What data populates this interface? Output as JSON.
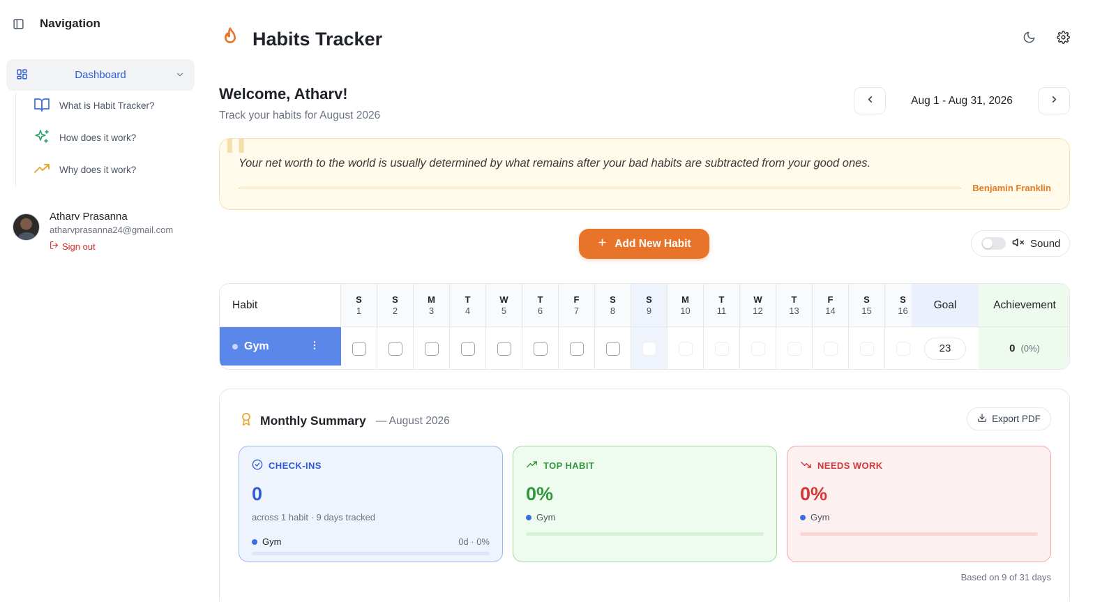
{
  "sidebar": {
    "title": "Navigation",
    "dashboard_label": "Dashboard",
    "items": [
      {
        "label": "What is Habit Tracker?",
        "icon": "book-open-icon"
      },
      {
        "label": "How does it work?",
        "icon": "sparkles-icon"
      },
      {
        "label": "Why does it work?",
        "icon": "trending-up-icon"
      }
    ],
    "user": {
      "name": "Atharv Prasanna",
      "email": "atharvprasanna24@gmail.com",
      "signout": "Sign out"
    }
  },
  "header": {
    "title": "Habits Tracker",
    "accent": "#e8742a"
  },
  "welcome": {
    "title": "Welcome, Atharv!",
    "subtitle": "Track your habits for August 2026"
  },
  "date_nav": {
    "range": "Aug 1 - Aug 31, 2026"
  },
  "quote": {
    "text": "Your net worth to the world is usually determined by what remains after your bad habits are subtracted from your good ones.",
    "author": "Benjamin Franklin"
  },
  "actions": {
    "add_habit": "Add New Habit",
    "sound_label": "Sound"
  },
  "table": {
    "habit_header": "Habit",
    "goal_header": "Goal",
    "achievement_header": "Achievement",
    "days": [
      {
        "w": "S",
        "n": "1"
      },
      {
        "w": "S",
        "n": "2"
      },
      {
        "w": "M",
        "n": "3"
      },
      {
        "w": "T",
        "n": "4"
      },
      {
        "w": "W",
        "n": "5"
      },
      {
        "w": "T",
        "n": "6"
      },
      {
        "w": "F",
        "n": "7"
      },
      {
        "w": "S",
        "n": "8"
      },
      {
        "w": "S",
        "n": "9"
      },
      {
        "w": "M",
        "n": "10"
      },
      {
        "w": "T",
        "n": "11"
      },
      {
        "w": "W",
        "n": "12"
      },
      {
        "w": "T",
        "n": "13"
      },
      {
        "w": "F",
        "n": "14"
      },
      {
        "w": "S",
        "n": "15"
      },
      {
        "w": "S",
        "n": "16"
      }
    ],
    "habit": {
      "name": "Gym",
      "color": "#5b86ea",
      "goal": "23",
      "achievement": "0",
      "achievement_pct": "(0%)"
    }
  },
  "summary": {
    "title": "Monthly Summary",
    "month": "— August 2026",
    "export": "Export PDF",
    "checkins": {
      "label": "CHECK-INS",
      "value": "0",
      "sub": "across 1 habit · 9 days tracked",
      "habit": "Gym",
      "stat": "0d · 0%"
    },
    "top": {
      "label": "TOP HABIT",
      "value": "0%",
      "habit": "Gym"
    },
    "needs": {
      "label": "NEEDS WORK",
      "value": "0%",
      "habit": "Gym"
    },
    "based": "Based on 9 of 31 days"
  }
}
